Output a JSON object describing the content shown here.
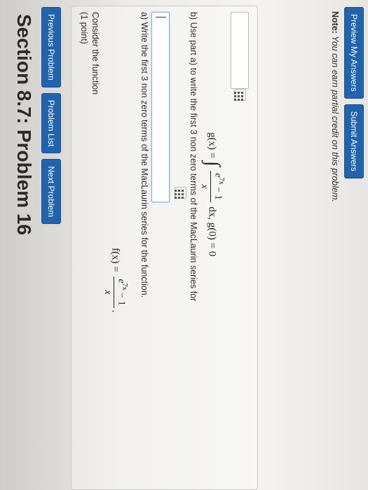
{
  "page_title": "Section 8.7: Problem 16",
  "nav": {
    "previous": "Previous Problem",
    "list": "Problem List",
    "next": "Next Problem"
  },
  "problem": {
    "points": "(1 point)",
    "intro": "Consider the function",
    "f_lhs": "f(x) =",
    "f_num": "e",
    "f_num_exp": "7x",
    "f_num_rest": " − 1",
    "f_den": "x",
    "f_end": ".",
    "part_a": "a) Write the first 3 non zero terms of the MacLaurin series for the function.",
    "part_b": "b) Use part a) to write the first 3 non zero terms of the MacLaurin series for",
    "g_lhs": "g(x) =",
    "g_integral": "∫",
    "g_num": "e",
    "g_num_exp": "7x",
    "g_num_rest": " − 1",
    "g_den": "x",
    "g_rest": "dx,  g(0) = 0"
  },
  "note": {
    "label": "Note:",
    "text": " You can earn partial credit on this problem."
  },
  "actions": {
    "preview": "Preview My Answers",
    "submit": "Submit Answers"
  },
  "colors": {
    "button_blue": "#1f64ad"
  }
}
